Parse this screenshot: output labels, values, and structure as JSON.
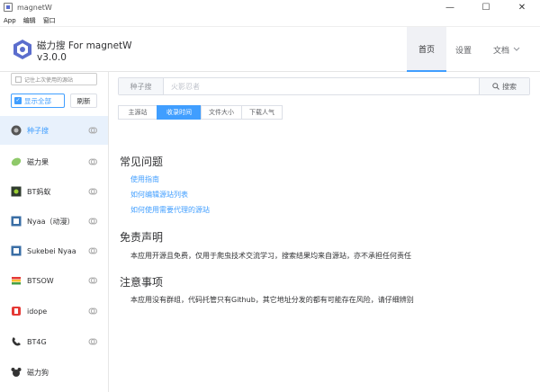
{
  "window": {
    "title": "magnetW",
    "minimize": "—",
    "maximize": "☐",
    "close": "✕"
  },
  "menubar": {
    "items": [
      "App",
      "编辑",
      "窗口"
    ]
  },
  "header": {
    "brand_title": "磁力搜 For magnetW",
    "version": "v3.0.0",
    "nav": {
      "home": "首页",
      "settings": "设置",
      "docs": "文档"
    }
  },
  "sidebar": {
    "remember_label": "记住上次使用的源站",
    "show_all_label": "显示全部",
    "refresh_label": "刷新",
    "items": [
      {
        "label": "种子搜",
        "icon": "seed-icon"
      },
      {
        "label": "磁力果",
        "icon": "fruit-icon"
      },
      {
        "label": "BT蚂蚁",
        "icon": "ant-icon"
      },
      {
        "label": "Nyaa（动漫）",
        "icon": "nyaa-icon"
      },
      {
        "label": "Sukebei Nyaa",
        "icon": "sukebei-icon"
      },
      {
        "label": "BTSOW",
        "icon": "btsow-icon"
      },
      {
        "label": "idope",
        "icon": "idope-icon"
      },
      {
        "label": "BT4G",
        "icon": "bt4g-icon"
      },
      {
        "label": "磁力狗",
        "icon": "dog-icon"
      }
    ]
  },
  "search": {
    "prefix": "种子搜",
    "placeholder": "火影忍者",
    "button_label": "搜索"
  },
  "sort": {
    "options": [
      "主源站",
      "收录时间",
      "文件大小",
      "下载人气"
    ],
    "active_index": 1
  },
  "content": {
    "faq_title": "常见问题",
    "faq_links": [
      "使用指南",
      "如何编辑源站列表",
      "如何使用需要代理的源站"
    ],
    "disclaimer_title": "免责声明",
    "disclaimer_text": "本应用开源且免费，仅用于爬虫技术交流学习，搜索结果均来自源站，亦不承担任何责任",
    "notes_title": "注意事项",
    "notes_text": "本应用没有群组，代码托管只有Github，其它地址分发的都有可能存在风险，请仔细辨别"
  },
  "colors": {
    "accent": "#409eff",
    "active_bg": "#e8f1fc"
  }
}
